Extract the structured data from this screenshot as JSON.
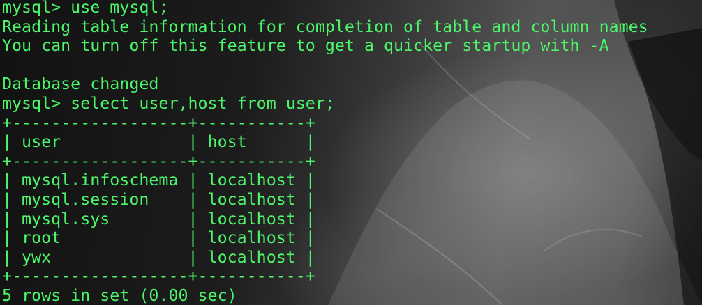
{
  "terminal": {
    "lines": [
      "mysql> use mysql;",
      "Reading table information for completion of table and column names",
      "You can turn off this feature to get a quicker startup with -A",
      "",
      "Database changed",
      "mysql> select user,host from user;",
      "+------------------+-----------+",
      "| user             | host      |",
      "+------------------+-----------+",
      "| mysql.infoschema | localhost |",
      "| mysql.session    | localhost |",
      "| mysql.sys        | localhost |",
      "| root             | localhost |",
      "| ywx              | localhost |",
      "+------------------+-----------+",
      "5 rows in set (0.00 sec)"
    ],
    "text_color": "#4cf56a"
  }
}
